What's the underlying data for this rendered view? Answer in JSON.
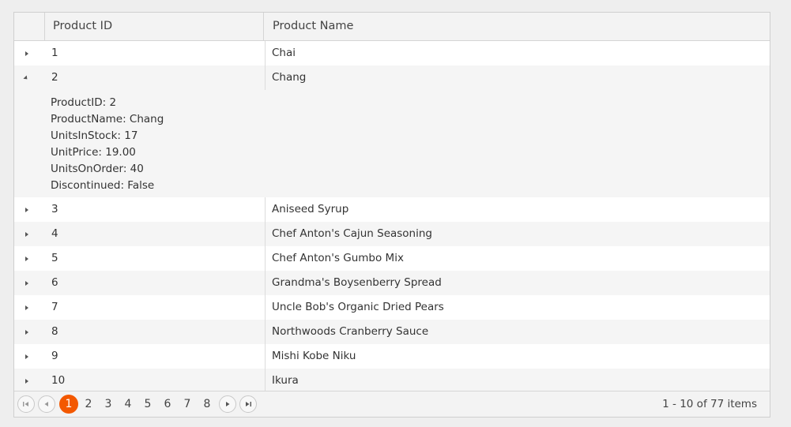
{
  "columns": {
    "product_id": "Product ID",
    "product_name": "Product Name"
  },
  "rows": [
    {
      "id": "1",
      "name": "Chai"
    },
    {
      "id": "2",
      "name": "Chang"
    },
    {
      "id": "3",
      "name": "Aniseed Syrup"
    },
    {
      "id": "4",
      "name": "Chef Anton's Cajun Seasoning"
    },
    {
      "id": "5",
      "name": "Chef Anton's Gumbo Mix"
    },
    {
      "id": "6",
      "name": "Grandma's Boysenberry Spread"
    },
    {
      "id": "7",
      "name": "Uncle Bob's Organic Dried Pears"
    },
    {
      "id": "8",
      "name": "Northwoods Cranberry Sauce"
    },
    {
      "id": "9",
      "name": "Mishi Kobe Niku"
    },
    {
      "id": "10",
      "name": "Ikura"
    }
  ],
  "detail": {
    "lines": [
      "ProductID: 2",
      "ProductName: Chang",
      "UnitsInStock: 17",
      "UnitPrice: 19.00",
      "UnitsOnOrder: 40",
      "Discontinued: False"
    ]
  },
  "pager": {
    "pages": [
      "1",
      "2",
      "3",
      "4",
      "5",
      "6",
      "7",
      "8"
    ],
    "current_page": "1",
    "info": "1 - 10 of 77 items"
  },
  "colors": {
    "accent": "#f35800",
    "alt_row": "#f5f5f5",
    "header_bg": "#f3f3f3"
  }
}
